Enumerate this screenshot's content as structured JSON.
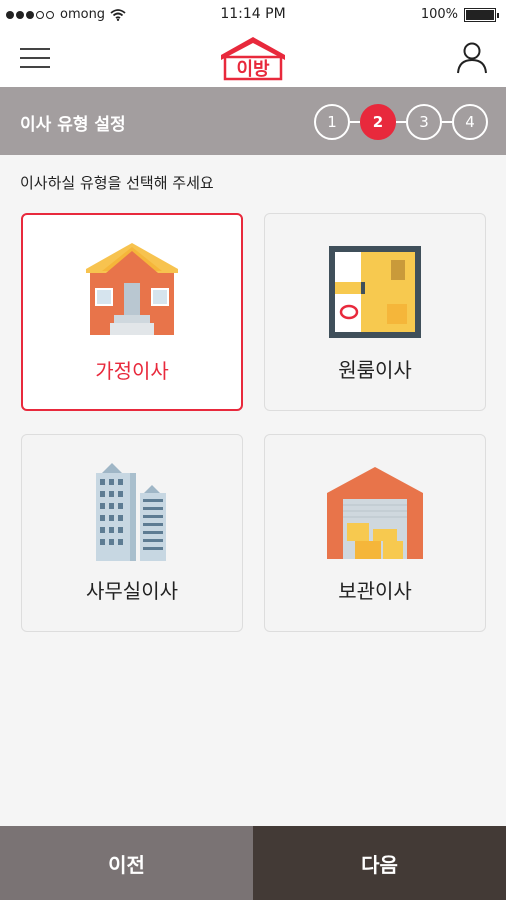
{
  "status_bar": {
    "carrier": "omong",
    "time": "11:14 PM",
    "battery": "100%",
    "battery_level": 1.0,
    "signal_bars": 3,
    "wifi_icon": "wifi-icon"
  },
  "header": {
    "menu_icon": "hamburger-menu-icon",
    "logo_text": "이방",
    "user_icon": "user-icon"
  },
  "step_bar": {
    "title": "이사 유형 설정",
    "steps": [
      "1",
      "2",
      "3",
      "4"
    ],
    "active_step": "2"
  },
  "prompt": "이사하실 유형을 선택해 주세요",
  "options": [
    {
      "label": "가정이사",
      "icon": "house-icon",
      "selected": true
    },
    {
      "label": "원룸이사",
      "icon": "studio-floorplan-icon",
      "selected": false
    },
    {
      "label": "사무실이사",
      "icon": "office-building-icon",
      "selected": false
    },
    {
      "label": "보관이사",
      "icon": "storage-warehouse-icon",
      "selected": false
    }
  ],
  "footer": {
    "prev_label": "이전",
    "next_label": "다음"
  },
  "colors": {
    "accent": "#e8293c",
    "step_bar_bg": "#a39e9f",
    "prev_bg": "#7a7374",
    "next_bg": "#433a36"
  }
}
